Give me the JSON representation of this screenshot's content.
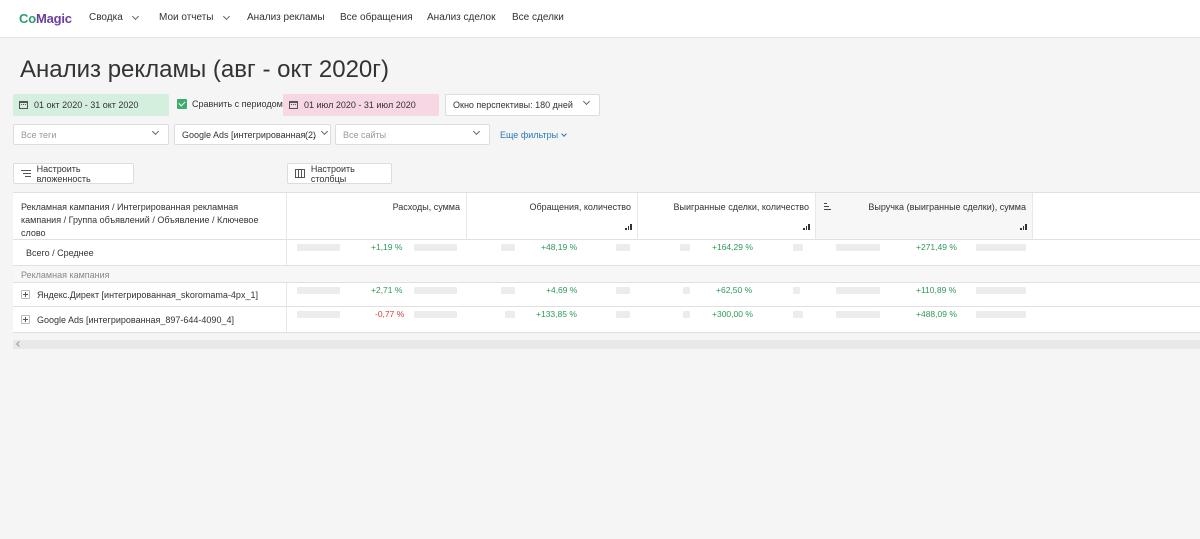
{
  "nav": {
    "logo_part1": "Co",
    "logo_part2": "Magic",
    "items": [
      {
        "label": "Сводка",
        "dropdown": true
      },
      {
        "label": "Мои отчеты",
        "dropdown": true
      },
      {
        "label": "Анализ рекламы",
        "dropdown": false
      },
      {
        "label": "Все обращения",
        "dropdown": false
      },
      {
        "label": "Анализ сделок",
        "dropdown": false
      },
      {
        "label": "Все сделки",
        "dropdown": false
      }
    ]
  },
  "page_title": "Анализ рекламы (авг - окт 2020г)",
  "filters": {
    "period_main": "01 окт 2020 - 31 окт 2020",
    "compare_label": "Сравнить с периодом",
    "compare_checked": true,
    "period_compare": "01 июл 2020 - 31 июл 2020",
    "horizon": "Окно перспективы:  180 дней",
    "tags": "Все теги",
    "ads": "Google Ads [интегрированная ...",
    "ads_count": "(2)",
    "sites": "Все сайты",
    "more": "Еще фильтры"
  },
  "buttons": {
    "nesting": "Настроить вложенность",
    "columns": "Настроить столбцы"
  },
  "table": {
    "first_header": "Рекламная кампания / Интегрированная рекламная кампания / Группа объявлений / Объявление / Ключевое слово",
    "columns": [
      "Расходы, сумма",
      "Обращения, количество",
      "Выигранные сделки, количество",
      "Выручка (выигранные сделки), сумма"
    ],
    "total_label": "Всего / Среднее",
    "total_values": [
      "+1,19 %",
      "+48,19 %",
      "+164,29 %",
      "+271,49 %"
    ],
    "group_label": "Рекламная кампания",
    "rows": [
      {
        "name": "Яндекс.Директ [интегрированная_skoromama-4px_1]",
        "values": [
          "+2,71 %",
          "+4,69 %",
          "+62,50 %",
          "+110,89 %"
        ]
      },
      {
        "name": "Google Ads [интегрированная_897-644-4090_4]",
        "values": [
          "-0,77 %",
          "+133,85 %",
          "+300,00 %",
          "+488,09 %"
        ]
      }
    ]
  },
  "colors": {
    "accent_green": "#3cae6b",
    "positive": "#2e9a57",
    "negative": "#d83b3b",
    "link": "#2a7ab8"
  }
}
